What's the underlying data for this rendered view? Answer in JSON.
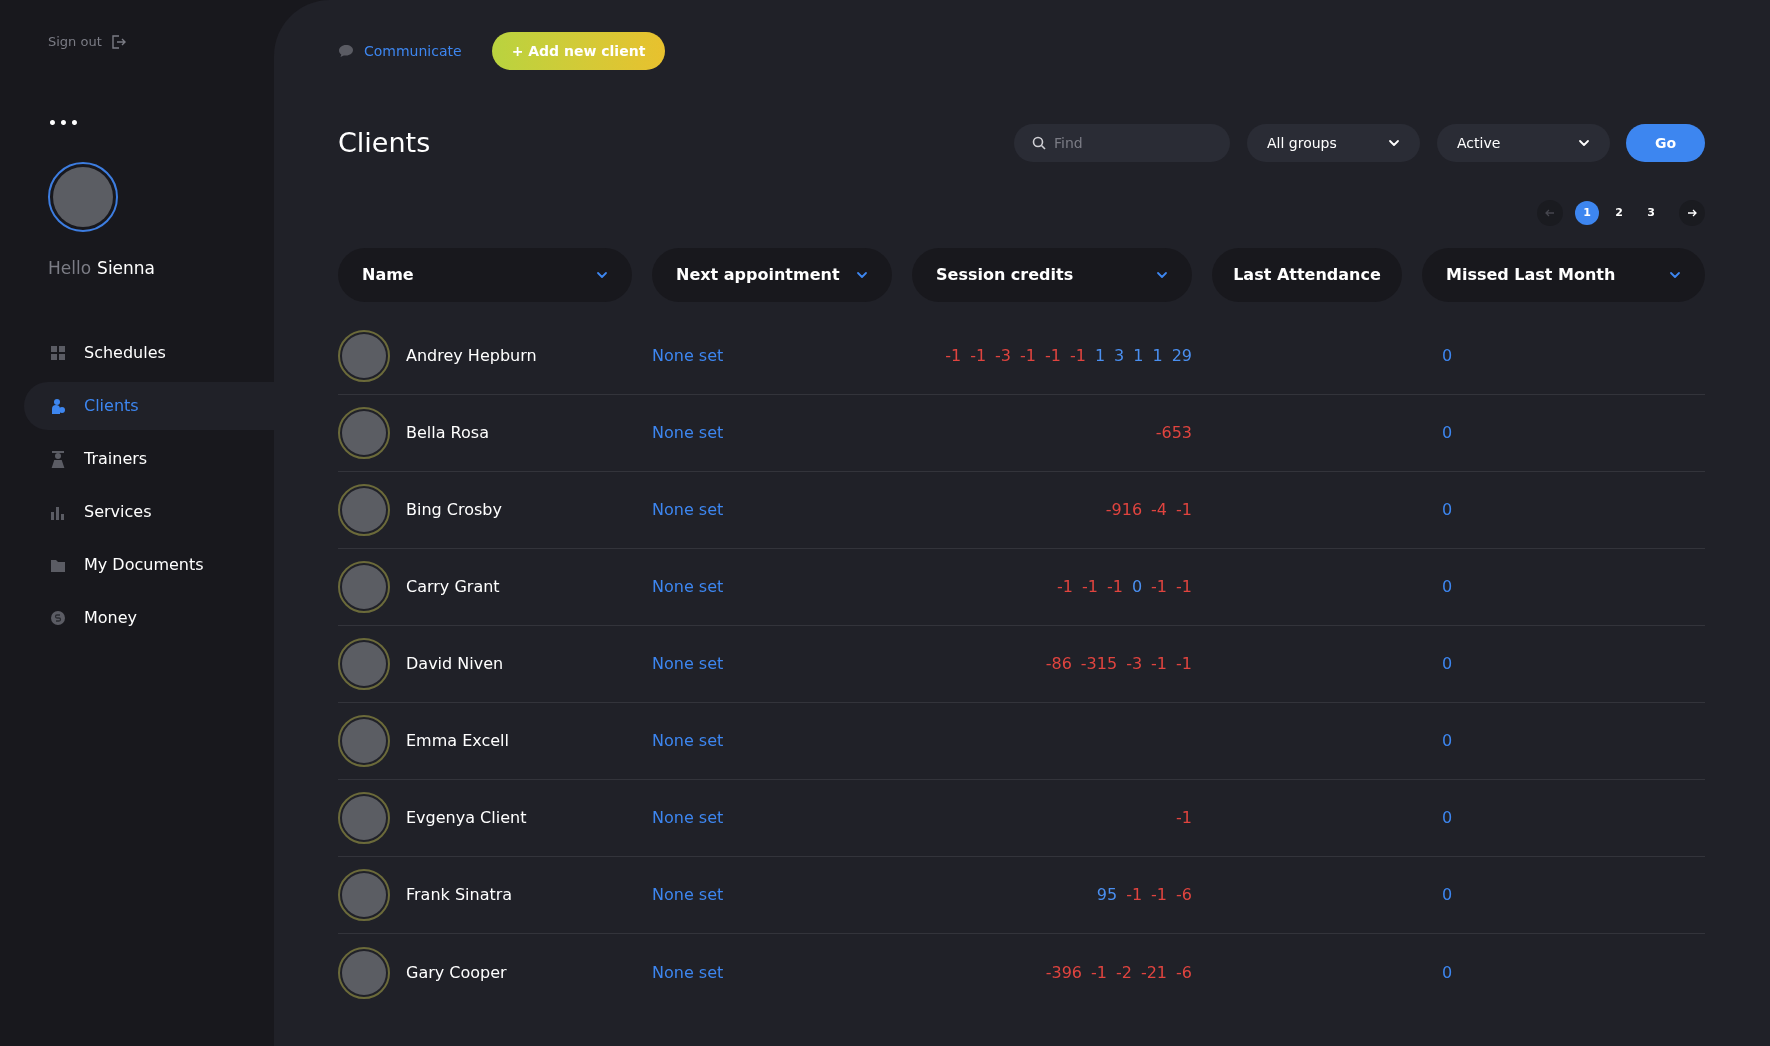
{
  "sidebar": {
    "sign_out": "Sign out",
    "menu_icon": "•••",
    "greeting": "Hello",
    "user_name": "Sienna",
    "items": [
      {
        "label": "Schedules",
        "selected": false
      },
      {
        "label": "Clients",
        "selected": true
      },
      {
        "label": "Trainers",
        "selected": false
      },
      {
        "label": "Services",
        "selected": false
      },
      {
        "label": "My Documents",
        "selected": false
      },
      {
        "label": "Money",
        "selected": false
      }
    ]
  },
  "toolbar": {
    "communicate": "Communicate",
    "add_button": "+ Add new client"
  },
  "title": "Clients",
  "filters": {
    "search": {
      "placeholder": "Find"
    },
    "group": "All groups",
    "status": "Active",
    "go": "Go"
  },
  "pagination": {
    "pages": [
      {
        "label": "1",
        "selected": true
      },
      {
        "label": "2",
        "selected": false
      },
      {
        "label": "3",
        "selected": false
      }
    ],
    "prev_disabled": true
  },
  "table": {
    "columns": [
      {
        "label": "Name",
        "sortable": true
      },
      {
        "label": "Next appointment",
        "sortable": true
      },
      {
        "label": "Session credits",
        "sortable": true
      },
      {
        "label": "Last Attendance",
        "sortable": false
      },
      {
        "label": "Missed Last Month",
        "sortable": true
      }
    ],
    "rows": [
      {
        "name": "Andrey Hepburn",
        "next": "None set",
        "credits": [
          {
            "value": "-1",
            "color": "#e0443f"
          },
          {
            "value": "-1",
            "color": "#e0443f"
          },
          {
            "value": "-3",
            "color": "#e0443f"
          },
          {
            "value": "-1",
            "color": "#e0443f"
          },
          {
            "value": "-1",
            "color": "#e0443f"
          },
          {
            "value": "-1",
            "color": "#e0443f"
          },
          {
            "value": "1",
            "color": "#4a8ff0"
          },
          {
            "value": "3",
            "color": "#4a8ff0"
          },
          {
            "value": "1",
            "color": "#4a8ff0"
          },
          {
            "value": "1",
            "color": "#4a8ff0"
          },
          {
            "value": "29",
            "color": "#4a8ff0"
          }
        ],
        "missed": "0"
      },
      {
        "name": "Bella Rosa",
        "next": "None set",
        "credits": [
          {
            "value": "-653",
            "color": "#e0443f"
          }
        ],
        "missed": "0"
      },
      {
        "name": "Bing Crosby",
        "next": "None set",
        "credits": [
          {
            "value": "-916",
            "color": "#e0443f"
          },
          {
            "value": "-4",
            "color": "#e0443f"
          },
          {
            "value": "-1",
            "color": "#e0443f"
          }
        ],
        "missed": "0"
      },
      {
        "name": "Carry Grant",
        "next": "None set",
        "credits": [
          {
            "value": "-1",
            "color": "#e0443f"
          },
          {
            "value": "-1",
            "color": "#e0443f"
          },
          {
            "value": "-1",
            "color": "#e0443f"
          },
          {
            "value": "0",
            "color": "#4a8ff0"
          },
          {
            "value": "-1",
            "color": "#e0443f"
          },
          {
            "value": "-1",
            "color": "#e0443f"
          }
        ],
        "missed": "0"
      },
      {
        "name": "David Niven",
        "next": "None set",
        "credits": [
          {
            "value": "-86",
            "color": "#e0443f"
          },
          {
            "value": "-315",
            "color": "#e0443f"
          },
          {
            "value": "-3",
            "color": "#e0443f"
          },
          {
            "value": "-1",
            "color": "#e0443f"
          },
          {
            "value": "-1",
            "color": "#e0443f"
          }
        ],
        "missed": "0"
      },
      {
        "name": "Emma Excell",
        "next": "None set",
        "missed": "0"
      },
      {
        "name": "Evgenya Client",
        "next": "None set",
        "credits": [
          {
            "value": "-1",
            "color": "#e0443f"
          }
        ],
        "missed": "0"
      },
      {
        "name": "Frank Sinatra",
        "next": "None set",
        "credits": [
          {
            "value": "95",
            "color": "#4a8ff0"
          },
          {
            "value": "-1",
            "color": "#e0443f"
          },
          {
            "value": "-1",
            "color": "#e0443f"
          },
          {
            "value": "-6",
            "color": "#e0443f"
          }
        ],
        "missed": "0"
      },
      {
        "name": "Gary Cooper",
        "next": "None set",
        "credits": [
          {
            "value": "-396",
            "color": "#e0443f"
          },
          {
            "value": "-1",
            "color": "#e0443f"
          },
          {
            "value": "-2",
            "color": "#e0443f"
          },
          {
            "value": "-21",
            "color": "#e0443f"
          },
          {
            "value": "-6",
            "color": "#e0443f"
          }
        ],
        "missed": "0"
      }
    ]
  }
}
